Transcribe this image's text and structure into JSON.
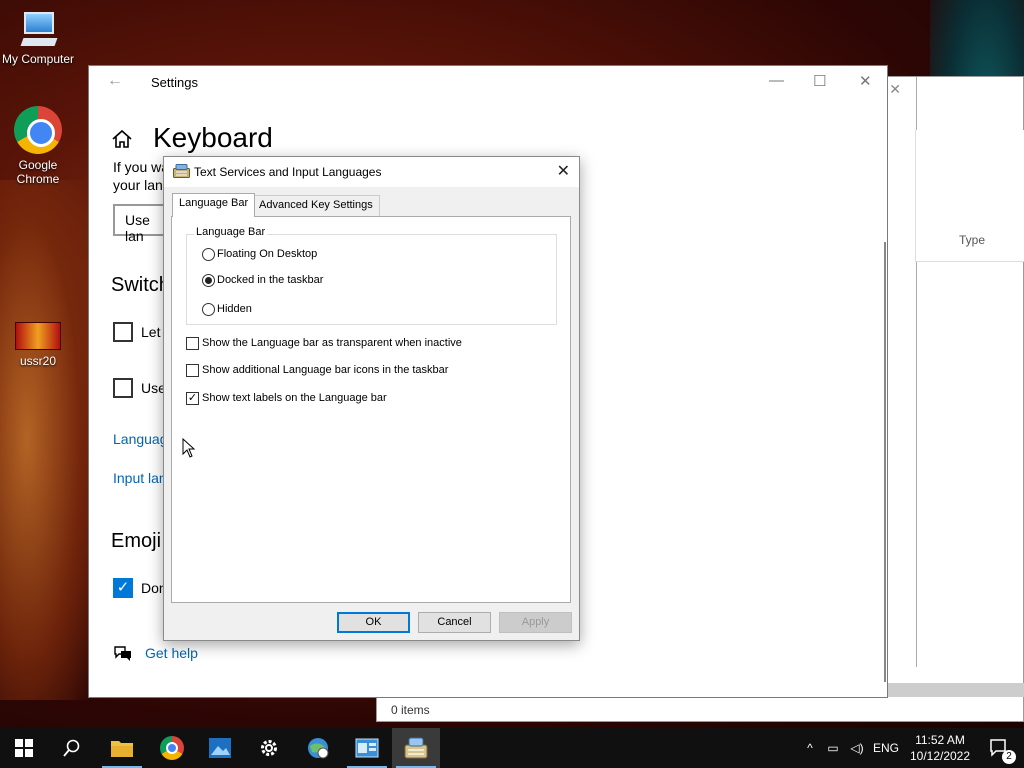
{
  "desktop": {
    "icons": [
      {
        "label": "My Computer"
      },
      {
        "label": "Google Chrome"
      },
      {
        "label": "ussr20"
      }
    ]
  },
  "explorer": {
    "column_type": "Type",
    "status": "0 items"
  },
  "settings": {
    "window_title": "Settings",
    "page_title": "Keyboard",
    "para_line1": "If you wa",
    "para_line2": "your lang",
    "combo_value": "Use lan",
    "section_switch": "Switch",
    "check1_label": "Let",
    "check2_label": "Use",
    "link_language": "Languag",
    "link_input": "Input lan",
    "section_emoji": "Emoji",
    "check3_label": "Don",
    "help_label": "Get help"
  },
  "dialog": {
    "title": "Text Services and Input Languages",
    "tabs": [
      {
        "label": "Language Bar"
      },
      {
        "label": "Advanced Key Settings"
      }
    ],
    "group_label": "Language Bar",
    "radios": [
      {
        "label": "Floating On Desktop",
        "checked": false
      },
      {
        "label": "Docked in the taskbar",
        "checked": true
      },
      {
        "label": "Hidden",
        "checked": false
      }
    ],
    "checkboxes": [
      {
        "label": "Show the Language bar as transparent when inactive",
        "checked": false
      },
      {
        "label": "Show additional Language bar icons in the taskbar",
        "checked": false
      },
      {
        "label": "Show text labels on the Language bar",
        "checked": true
      }
    ],
    "buttons": {
      "ok": "OK",
      "cancel": "Cancel",
      "apply": "Apply"
    }
  },
  "taskbar": {
    "language": "ENG",
    "time": "11:52 AM",
    "date": "10/12/2022",
    "notification_count": "2"
  },
  "colors": {
    "accent": "#0078d7",
    "link": "#0066b4",
    "taskbar": "#101010"
  }
}
